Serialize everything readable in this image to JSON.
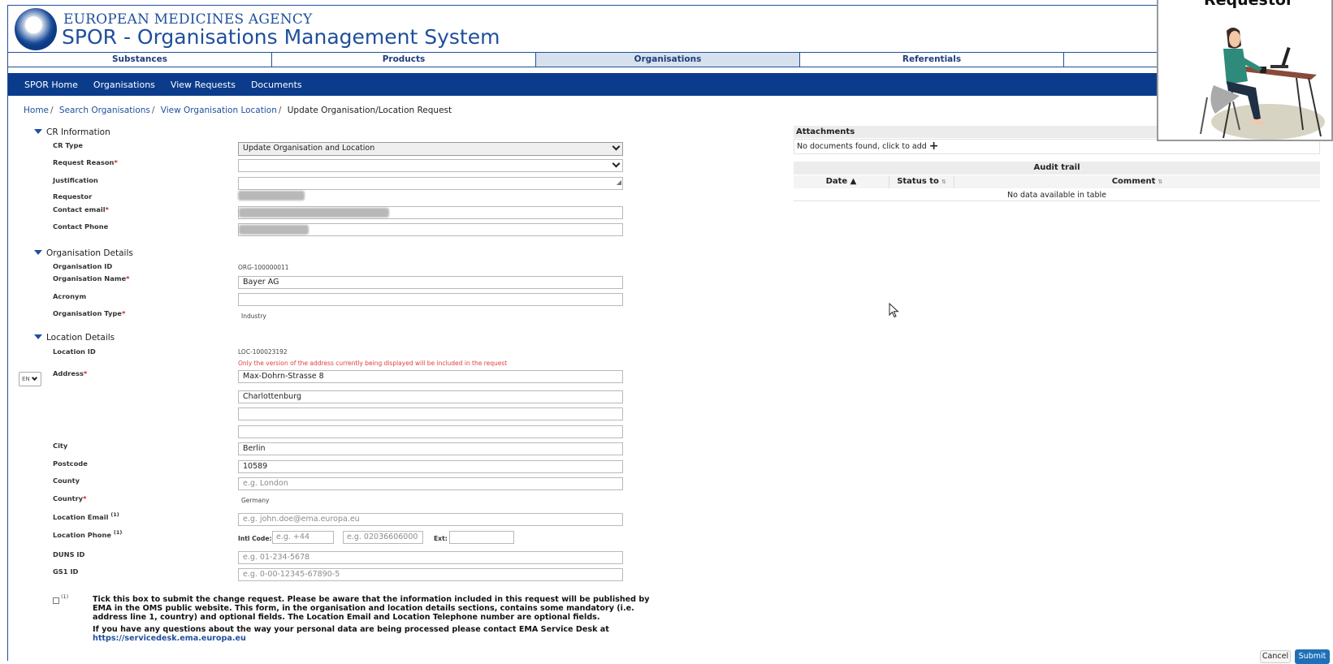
{
  "header": {
    "agency": "EUROPEAN MEDICINES AGENCY",
    "title": "SPOR - Organisations Management System"
  },
  "tabs": [
    "Substances",
    "Products",
    "Organisations",
    "Referentials",
    ""
  ],
  "nav": [
    "SPOR Home",
    "Organisations",
    "View Requests",
    "Documents"
  ],
  "breadcrumb": {
    "home": "Home",
    "search": "Search Organisations",
    "view": "View Organisation Location",
    "current": "Update Organisation/Location Request",
    "sep": "/"
  },
  "cr_info": {
    "heading": "CR Information",
    "cr_type_label": "CR Type",
    "cr_type_value": "Update Organisation and Location",
    "request_reason_label": "Request Reason",
    "justification_label": "Justification",
    "requestor_label": "Requestor",
    "contact_email_label": "Contact email",
    "contact_phone_label": "Contact Phone"
  },
  "org": {
    "heading": "Organisation Details",
    "id_label": "Organisation ID",
    "id_value": "ORG-100000011",
    "name_label": "Organisation Name",
    "name_value": "Bayer AG",
    "acronym_label": "Acronym",
    "type_label": "Organisation Type",
    "type_value": "Industry"
  },
  "location": {
    "heading": "Location Details",
    "id_label": "Location ID",
    "id_value": "LOC-100023192",
    "warning": "Only the version of the address currently being displayed will be included in the request",
    "lang": "EN",
    "address_label": "Address",
    "address1": "Max-Dohrn-Strasse 8",
    "address2": "Charlottenburg",
    "city_label": "City",
    "city_value": "Berlin",
    "postcode_label": "Postcode",
    "postcode_value": "10589",
    "county_label": "County",
    "county_placeholder": "e.g. London",
    "country_label": "Country",
    "country_value": "Germany",
    "email_label": "Location Email",
    "email_placeholder": "e.g. john.doe@ema.europa.eu",
    "phone_label": "Location Phone",
    "intl_code_label": "Intl Code:",
    "intl_code_placeholder": "e.g. +44",
    "phone_placeholder": "e.g. 02036606000",
    "ext_label": "Ext:",
    "duns_label": "DUNS ID",
    "duns_placeholder": "e.g. 01-234-5678",
    "gs1_label": "GS1 ID",
    "gs1_placeholder": "e.g. 0-00-12345-67890-5",
    "footnote_mark": "(1)",
    "required_mark": "*"
  },
  "consent": {
    "sup": "(1)",
    "text": "Tick this box to submit the change request. Please be aware that the information included in this request will be published by EMA in the OMS public website. This form, in the organisation and location details sections, contains some mandatory (i.e. address line 1, country) and optional fields. The Location Email and Location Telephone number are optional fields.",
    "contact_text": "If you have any questions about the way your personal data are being processed please contact EMA Service Desk at",
    "link": "https://servicedesk.ema.europa.eu"
  },
  "attachments": {
    "heading": "Attachments",
    "empty": "No documents found, click to add",
    "add": "+"
  },
  "audit": {
    "title": "Audit trail",
    "columns": [
      "Date ▲",
      "Status to",
      "Comment"
    ],
    "sort_glyph": "⇅",
    "empty": "No data available in table"
  },
  "card": {
    "title": "Requestor"
  },
  "buttons": {
    "cancel": "Cancel",
    "submit": "Submit"
  }
}
